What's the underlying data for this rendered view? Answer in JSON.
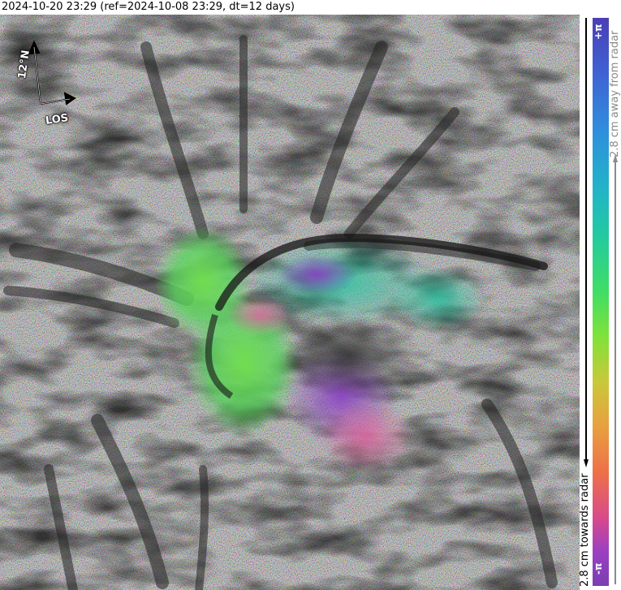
{
  "header": {
    "title": "2024-10-20 23:29 (ref=2024-10-08 23:29, dt=12 days)"
  },
  "compass": {
    "north_label": "12°N",
    "los_label": "LOS"
  },
  "colorbar": {
    "top_label": "+π",
    "bottom_label": "-π",
    "away_label": "2.8 cm away from radar",
    "towards_label": "2.8 cm towards radar",
    "colors": [
      "#4a3fb5",
      "#2f8fdc",
      "#22c9a2",
      "#3fdd66",
      "#c7c93a",
      "#ee7048",
      "#9b3fc2"
    ]
  }
}
